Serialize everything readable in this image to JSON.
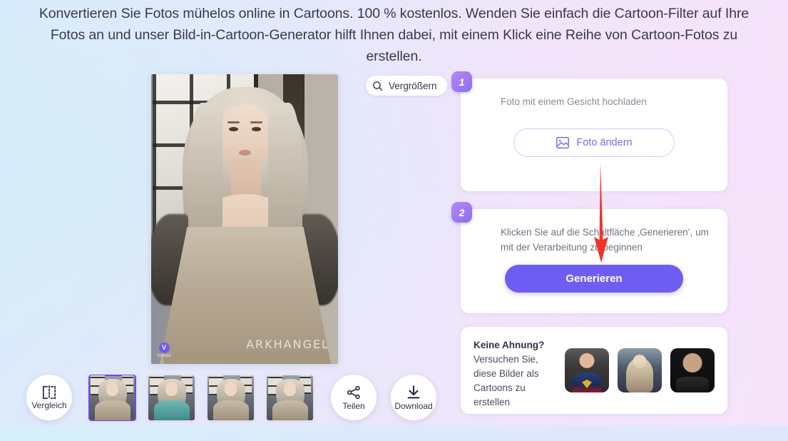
{
  "headline": "Konvertieren Sie Fotos mühelos online in Cartoons. 100 % kostenlos. Wenden Sie einfach die Cartoon-Filter auf Ihre Fotos an und unser Bild-in-Cartoon-Generator hilft Ihnen dabei, mit einem Klick eine Reihe von Cartoon-Fotos zu erstellen.",
  "preview": {
    "signature": "ARKHANGEL",
    "watermark_letter": "V",
    "watermark_text": "Vidnoz",
    "zoom_button_label": "Vergrößern",
    "zoom_icon": "search-icon"
  },
  "steps": [
    {
      "number": "1",
      "text": "Foto mit einem Gesicht hochladen",
      "button_label": "Foto ändern",
      "button_icon": "image-icon"
    },
    {
      "number": "2",
      "text": "Klicken Sie auf die Schaltfläche ‚Generieren‘, um mit der Verarbeitung zu beginnen",
      "button_label": "Generieren"
    }
  ],
  "ideas": {
    "title": "Keine Ahnung?",
    "body": "Versuchen Sie, diese Bilder als Cartoons zu erstellen",
    "samples": [
      {
        "name": "sample-superman"
      },
      {
        "name": "sample-blonde-woman"
      },
      {
        "name": "sample-bald-man"
      }
    ]
  },
  "toolbar": {
    "compare_label": "Vergleich",
    "compare_icon": "compare-icon",
    "share_label": "Teilen",
    "share_icon": "share-icon",
    "download_label": "Download",
    "download_icon": "download-icon"
  },
  "thumbnails": [
    {
      "index": "1",
      "selected": true
    },
    {
      "index": "2",
      "selected": false
    },
    {
      "index": "3",
      "selected": false
    },
    {
      "index": "4",
      "selected": false
    }
  ],
  "colors": {
    "accent_purple": "#6f5df2",
    "badge_purple": "#8e6df0",
    "arrow_red": "#f0342c",
    "card_white": "#ffffff",
    "text_dark": "#33334a",
    "text_muted": "#8a8a9a",
    "bg_left": "#d9ecfb",
    "bg_right": "#f6e3fa"
  }
}
